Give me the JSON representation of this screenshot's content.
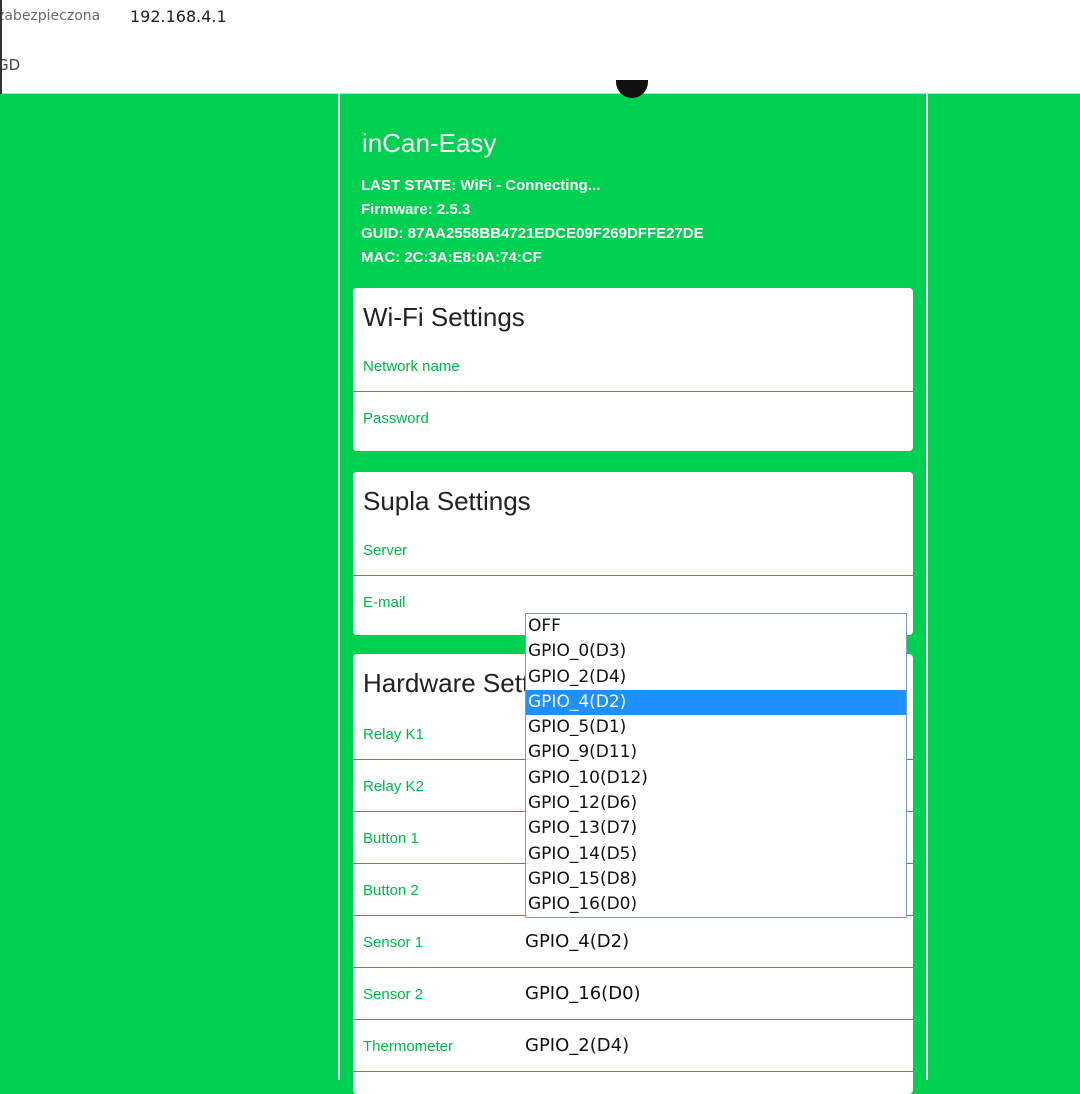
{
  "browser": {
    "security_text": "zabezpieczona",
    "url": "192.168.4.1",
    "bookmark": "GD"
  },
  "header": {
    "title": "inCan-Easy",
    "last_state": "LAST STATE: WiFi - Connecting...",
    "firmware": "Firmware: 2.5.3",
    "guid": "GUID: 87AA2558BB4721EDCE09F269DFFE27DE",
    "mac": "MAC: 2C:3A:E8:0A:74:CF"
  },
  "wifi": {
    "title": "Wi-Fi Settings",
    "network_label": "Network name",
    "password_label": "Password"
  },
  "supla": {
    "title": "Supla Settings",
    "server_label": "Server",
    "email_label": "E-mail"
  },
  "hardware": {
    "title": "Hardware Settings",
    "rows": [
      {
        "label": "Relay K1",
        "value": ""
      },
      {
        "label": "Relay K2",
        "value": ""
      },
      {
        "label": "Button 1",
        "value": ""
      },
      {
        "label": "Button 2",
        "value": ""
      },
      {
        "label": "Sensor 1",
        "value": "GPIO_4(D2)"
      },
      {
        "label": "Sensor 2",
        "value": "GPIO_16(D0)"
      },
      {
        "label": "Thermometer",
        "value": "GPIO_2(D4)"
      }
    ]
  },
  "dropdown": {
    "options": [
      "OFF",
      "GPIO_0(D3)",
      "GPIO_2(D4)",
      "GPIO_4(D2)",
      "GPIO_5(D1)",
      "GPIO_9(D11)",
      "GPIO_10(D12)",
      "GPIO_12(D6)",
      "GPIO_13(D7)",
      "GPIO_14(D5)",
      "GPIO_15(D8)",
      "GPIO_16(D0)"
    ],
    "selected": "GPIO_4(D2)"
  },
  "colors": {
    "page_bg": "#00d050",
    "label_green": "#00b848",
    "selected_bg": "#1e90ff"
  }
}
